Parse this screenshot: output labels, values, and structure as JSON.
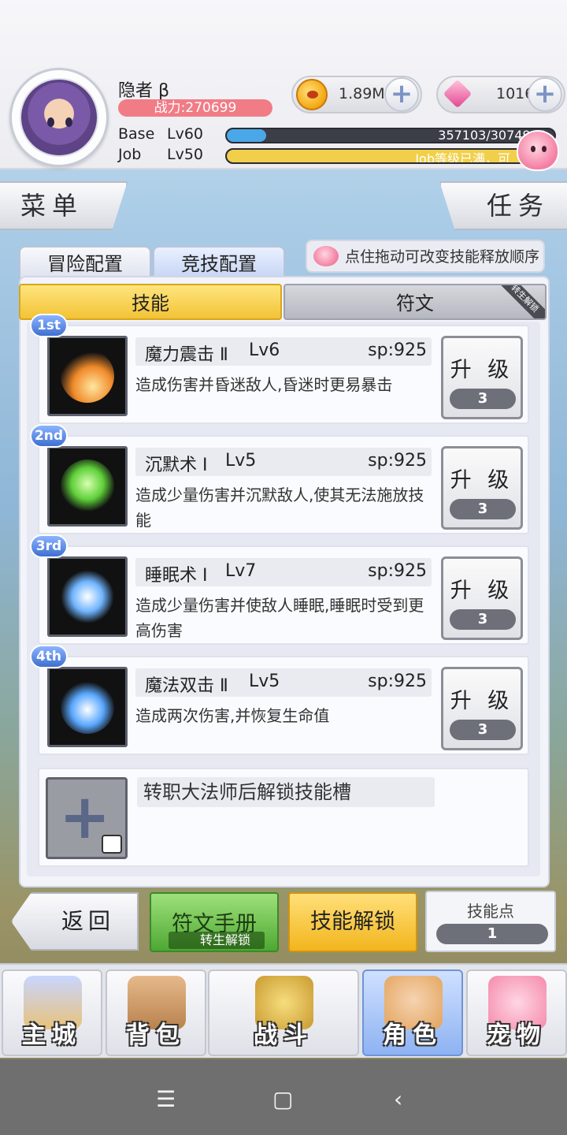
{
  "player": {
    "name": "隐者 β",
    "combat_power": "战力:270699"
  },
  "resources": {
    "coins": "1.89M",
    "gems": "1016"
  },
  "levels": {
    "base_label": "Base",
    "base_level": "Lv60",
    "base_exp_text": "357103/3074900",
    "base_progress": 0.12,
    "job_label": "Job",
    "job_level": "Lv50",
    "job_exp_text": "Job等级已满，可",
    "job_progress": 1.0
  },
  "side_tabs": {
    "menu": "菜单",
    "task": "任务"
  },
  "config_tabs": {
    "adventure": "冒险配置",
    "arena": "竞技配置"
  },
  "hint": "点住拖动可改变技能释放顺序",
  "sub_tabs": {
    "skills": "技能",
    "runes": "符文",
    "runes_ribbon": "转生解锁"
  },
  "skills": [
    {
      "rank": "1st",
      "name": "魔力震击 Ⅱ",
      "level": "Lv6",
      "sp": "sp:925",
      "desc": "造成伤害并昏迷敌人,昏迷时更易暴击",
      "upgrade_label": "升 级",
      "cost": "3"
    },
    {
      "rank": "2nd",
      "name": "沉默术 Ⅰ",
      "level": "Lv5",
      "sp": "sp:925",
      "desc": "造成少量伤害并沉默敌人,使其无法施放技能",
      "upgrade_label": "升 级",
      "cost": "3"
    },
    {
      "rank": "3rd",
      "name": "睡眠术 Ⅰ",
      "level": "Lv7",
      "sp": "sp:925",
      "desc": "造成少量伤害并使敌人睡眠,睡眠时受到更高伤害",
      "upgrade_label": "升 级",
      "cost": "3"
    },
    {
      "rank": "4th",
      "name": "魔法双击 Ⅱ",
      "level": "Lv5",
      "sp": "sp:925",
      "desc": "造成两次伤害,并恢复生命值",
      "upgrade_label": "升 级",
      "cost": "3"
    }
  ],
  "locked_slot": "转职大法师后解锁技能槽",
  "actions": {
    "back": "返回",
    "rune_manual": "符文手册",
    "rune_manual_sub": "转生解锁",
    "skill_unlock": "技能解锁",
    "skill_points_label": "技能点",
    "skill_points": "1"
  },
  "nav": {
    "city": "主城",
    "bag": "背包",
    "battle": "战斗",
    "character": "角色",
    "pet": "宠物"
  },
  "colors": {
    "power_badge": "#f17c86",
    "exp_fill": "#4aa8e8",
    "job_fill": "#f2cf4a",
    "active_tab": "#f2c336",
    "rune_button": "#4ea833"
  }
}
